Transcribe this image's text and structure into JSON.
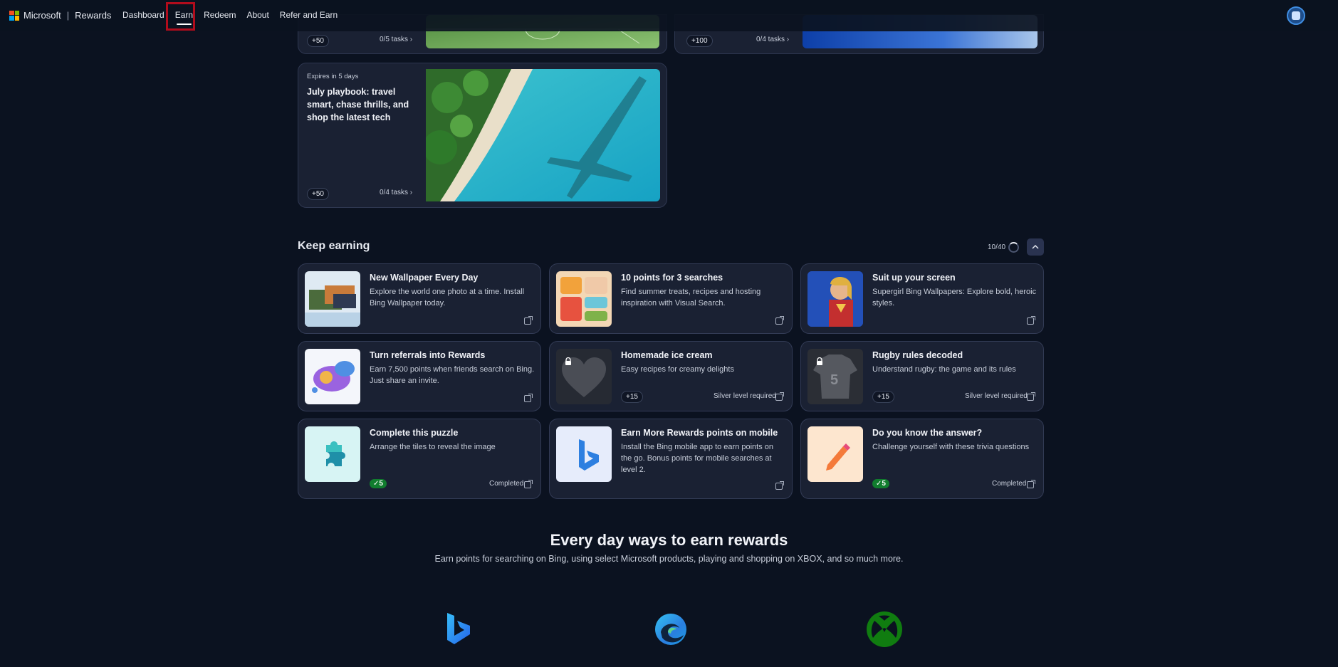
{
  "nav": {
    "brand": "Microsoft",
    "product": "Rewards",
    "links": [
      "Dashboard",
      "Earn",
      "Redeem",
      "About",
      "Refer and Earn"
    ],
    "active": "Earn"
  },
  "top_cards": [
    {
      "points": "+50",
      "tasks": "0/5 tasks"
    },
    {
      "points": "+100",
      "tasks": "0/4 tasks"
    }
  ],
  "playbook": {
    "expires": "Expires in 5 days",
    "title": "July playbook: travel smart, chase thrills, and shop the latest tech",
    "points": "+50",
    "tasks": "0/4 tasks"
  },
  "keep_earning": {
    "title": "Keep earning",
    "progress": "10/40",
    "cards": [
      {
        "title": "New Wallpaper Every Day",
        "desc": "Explore the world one photo at a time. Install Bing Wallpaper today."
      },
      {
        "title": "10 points for 3 searches",
        "desc": "Find summer treats, recipes and hosting inspiration with Visual Search."
      },
      {
        "title": "Suit up your screen",
        "desc": "Supergirl Bing Wallpapers: Explore bold, heroic styles."
      },
      {
        "title": "Turn referrals into Rewards",
        "desc": "Earn 7,500 points when friends search on Bing. Just share an invite."
      },
      {
        "title": "Homemade ice cream",
        "desc": "Easy recipes for creamy delights",
        "points": "+15",
        "req": "Silver level required"
      },
      {
        "title": "Rugby rules decoded",
        "desc": "Understand rugby: the game and its rules",
        "points": "+15",
        "req": "Silver level required"
      },
      {
        "title": "Complete this puzzle",
        "desc": "Arrange the tiles to reveal the image",
        "points": "5",
        "status": "Completed"
      },
      {
        "title": "Earn More Rewards points on mobile",
        "desc": "Install the Bing mobile app to earn points on the go. Bonus points for mobile searches at level 2."
      },
      {
        "title": "Do you know the answer?",
        "desc": "Challenge yourself with these trivia questions",
        "points": "5",
        "status": "Completed"
      }
    ]
  },
  "every_day": {
    "title": "Every day ways to earn rewards",
    "subtitle": "Earn points for searching on Bing, using select Microsoft products, playing and shopping on XBOX, and so much more."
  },
  "icons": [
    "microsoft-logo",
    "avatar-icon",
    "chevron-right-icon",
    "chevron-up-icon",
    "external-link-icon",
    "lock-icon",
    "check-icon",
    "puzzle-icon",
    "pencil-icon",
    "bing-logo",
    "edge-logo",
    "xbox-logo"
  ],
  "colors": {
    "background": "#0b1220",
    "card": "#1a2133",
    "accent_red": "#b10c1c",
    "completed_green": "#117d2e"
  }
}
